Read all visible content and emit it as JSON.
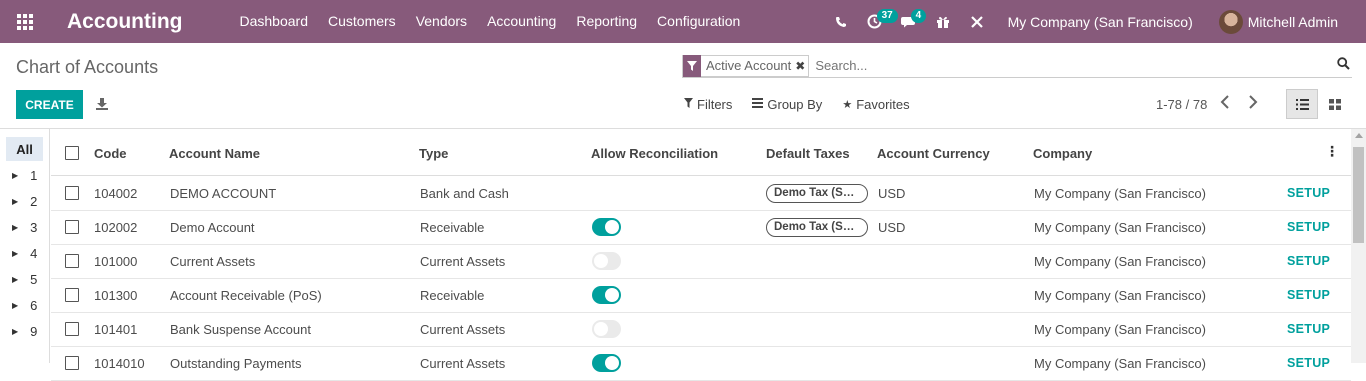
{
  "navbar": {
    "app_name": "Accounting",
    "menu": [
      "Dashboard",
      "Customers",
      "Vendors",
      "Accounting",
      "Reporting",
      "Configuration"
    ],
    "activity_count": "37",
    "messages_count": "4",
    "company": "My Company (San Francisco)",
    "user": "Mitchell Admin",
    "color": "#875a7b"
  },
  "breadcrumb": "Chart of Accounts",
  "search": {
    "facet": "Active Account",
    "placeholder": "Search..."
  },
  "buttons": {
    "create": "CREATE",
    "filters": "Filters",
    "group_by": "Group By",
    "favorites": "Favorites"
  },
  "pager": "1-78 / 78",
  "side_panel": {
    "all": "All",
    "items": [
      "1",
      "2",
      "3",
      "4",
      "5",
      "6",
      "9"
    ]
  },
  "table": {
    "headers": {
      "code": "Code",
      "name": "Account Name",
      "type": "Type",
      "reconcile": "Allow Reconciliation",
      "taxes": "Default Taxes",
      "currency": "Account Currency",
      "company": "Company"
    },
    "setup_label": "SETUP",
    "rows": [
      {
        "code": "104002",
        "name": "DEMO ACCOUNT",
        "type": "Bank and Cash",
        "reconcile": null,
        "tax": "Demo Tax (Sal...",
        "currency": "USD",
        "company": "My Company (San Francisco)"
      },
      {
        "code": "102002",
        "name": "Demo Account",
        "type": "Receivable",
        "reconcile": true,
        "tax": "Demo Tax (Sal...",
        "currency": "USD",
        "company": "My Company (San Francisco)"
      },
      {
        "code": "101000",
        "name": "Current Assets",
        "type": "Current Assets",
        "reconcile": false,
        "tax": "",
        "currency": "",
        "company": "My Company (San Francisco)"
      },
      {
        "code": "101300",
        "name": "Account Receivable (PoS)",
        "type": "Receivable",
        "reconcile": true,
        "tax": "",
        "currency": "",
        "company": "My Company (San Francisco)"
      },
      {
        "code": "101401",
        "name": "Bank Suspense Account",
        "type": "Current Assets",
        "reconcile": false,
        "tax": "",
        "currency": "",
        "company": "My Company (San Francisco)"
      },
      {
        "code": "1014010",
        "name": "Outstanding Payments",
        "type": "Current Assets",
        "reconcile": true,
        "tax": "",
        "currency": "",
        "company": "My Company (San Francisco)"
      }
    ]
  },
  "colors": {
    "accent": "#00a09d",
    "brand": "#875a7b"
  }
}
